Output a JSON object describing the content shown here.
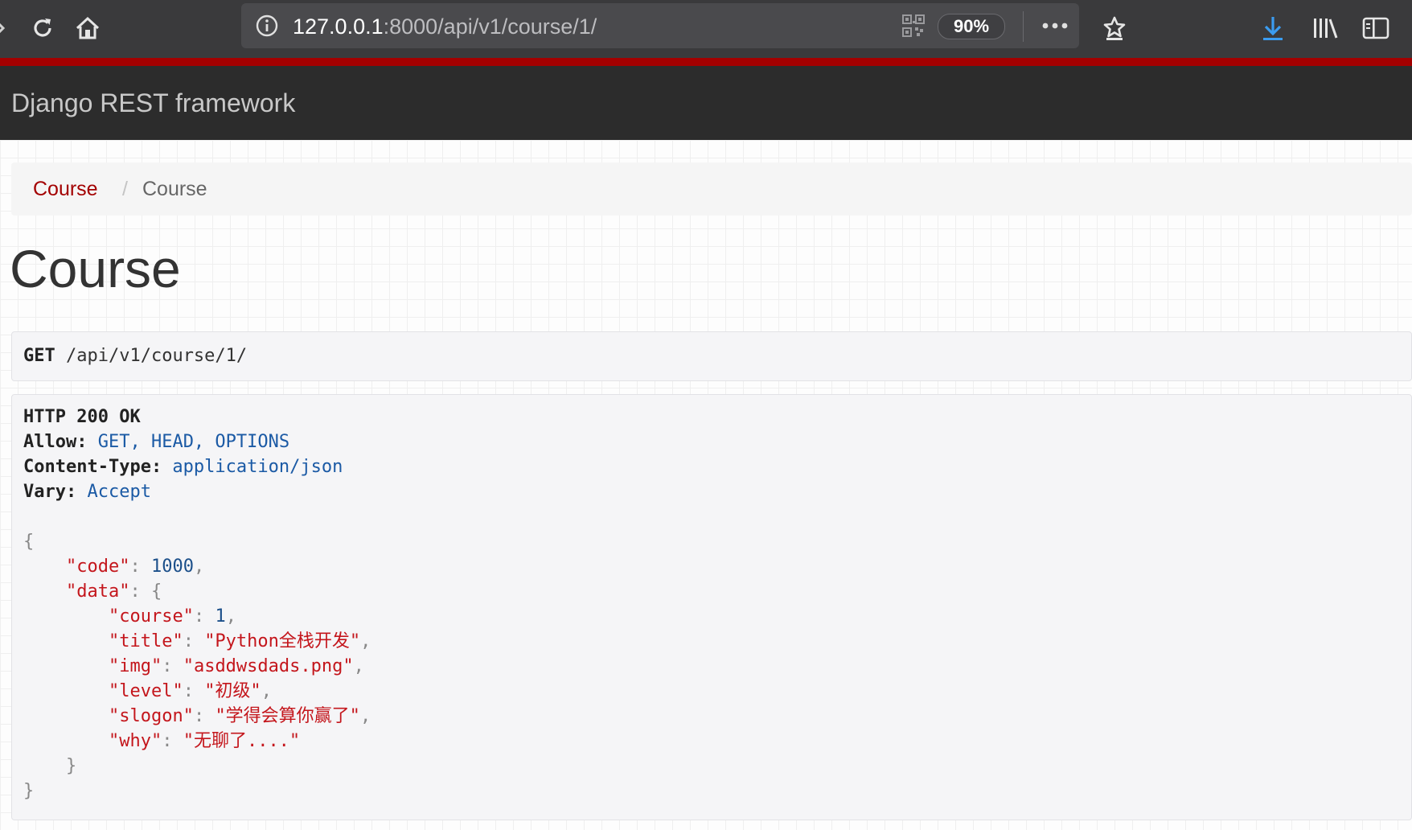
{
  "browser": {
    "url_host": "127.0.0.1",
    "url_rest": ":8000/api/v1/course/1/",
    "zoom": "90%",
    "icons": [
      "back-arrow-icon",
      "reload-icon",
      "home-icon",
      "site-info-icon",
      "qr-code-icon",
      "more-icon",
      "bookmark-star-icon",
      "download-icon",
      "library-icon",
      "sidebar-icon"
    ]
  },
  "navbar": {
    "brand": "Django REST framework"
  },
  "breadcrumb": {
    "link": "Course",
    "separator": "/",
    "active": "Course"
  },
  "page": {
    "title": "Course"
  },
  "request": {
    "method": "GET",
    "path": " /api/v1/course/1/"
  },
  "response": {
    "status": "HTTP 200 OK",
    "headers": [
      {
        "name": "Allow:",
        "value": " GET, HEAD, OPTIONS"
      },
      {
        "name": "Content-Type:",
        "value": " application/json"
      },
      {
        "name": "Vary:",
        "value": " Accept"
      }
    ],
    "body": {
      "open": "{",
      "code_key": "\"code\"",
      "code_value": "1000",
      "data_key": "\"data\"",
      "data_open": "{",
      "fields": [
        {
          "key": "\"course\"",
          "value": "1",
          "type": "number"
        },
        {
          "key": "\"title\"",
          "value": "\"Python全栈开发\"",
          "type": "string"
        },
        {
          "key": "\"img\"",
          "value": "\"asddwsdads.png\"",
          "type": "string"
        },
        {
          "key": "\"level\"",
          "value": "\"初级\"",
          "type": "string"
        },
        {
          "key": "\"slogon\"",
          "value": "\"学得会算你赢了\"",
          "type": "string"
        },
        {
          "key": "\"why\"",
          "value": "\"无聊了....\"",
          "type": "string"
        }
      ],
      "data_close": "}",
      "close": "}"
    }
  },
  "colors": {
    "accent": "#a30000",
    "navbar": "#2c2c2c",
    "toolbar": "#3a3a3c",
    "download": "#3b9cf0"
  }
}
